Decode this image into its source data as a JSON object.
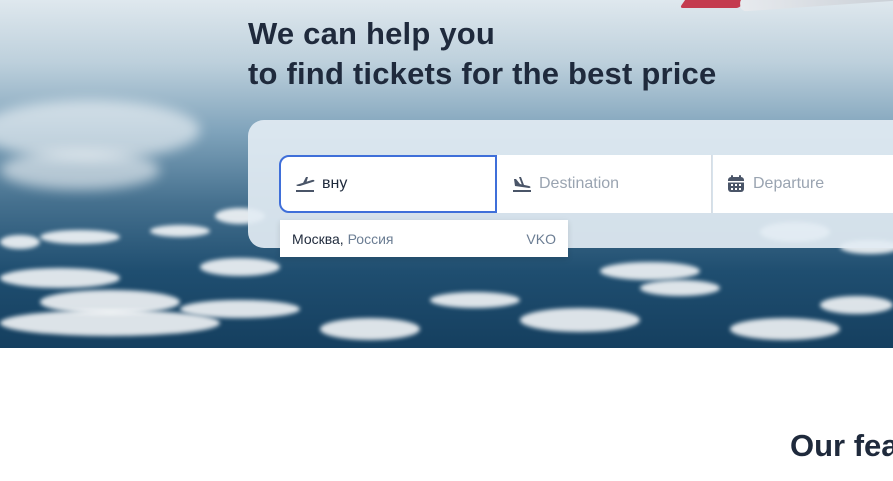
{
  "headline": {
    "line1": "We can help you",
    "line2": "to find tickets for the best price"
  },
  "search": {
    "origin": {
      "value": "вну",
      "icon": "plane-takeoff-icon"
    },
    "destination": {
      "placeholder": "Destination",
      "icon": "plane-landing-icon"
    },
    "departure": {
      "placeholder": "Departure",
      "icon": "calendar-icon"
    }
  },
  "suggestion": {
    "city": "Москва",
    "separator": ",",
    "country": "Россия",
    "code": "VKO"
  },
  "features": {
    "title": "Our fea"
  },
  "colors": {
    "text_dark": "#1f2a3c",
    "accent_border": "#3f6fd9",
    "muted": "#6b7d93"
  }
}
